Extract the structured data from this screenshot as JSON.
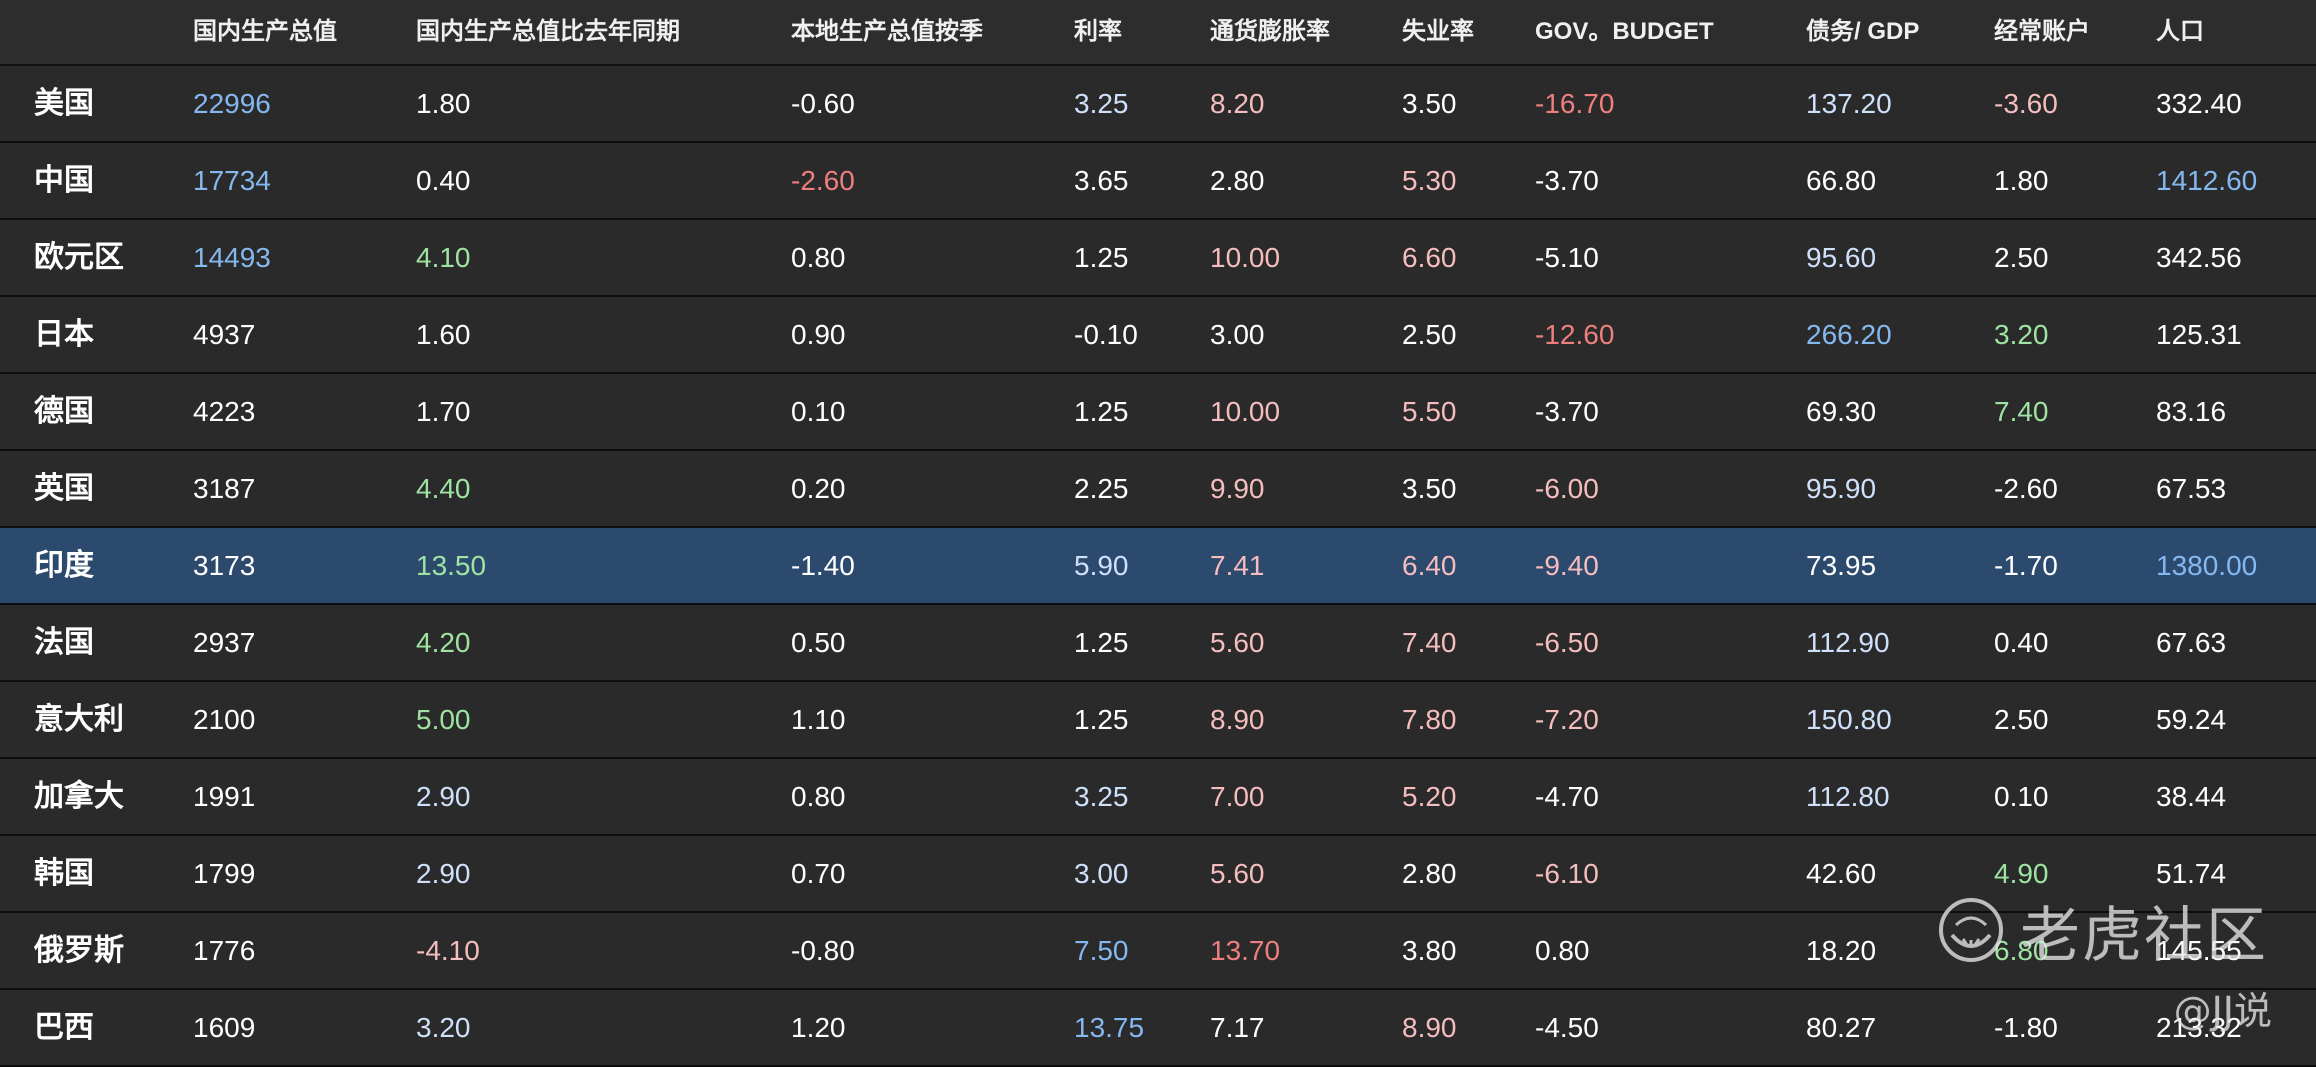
{
  "colors": {
    "background": "#2a2a2a",
    "highlight_row": "#2c4a6e",
    "white": "#ffffff",
    "blue": "#86b8f0",
    "light_blue": "#cfe0fb",
    "green": "#9ee3a2",
    "light_red": "#f5bdbd",
    "red": "#ef7f7f"
  },
  "table": {
    "headers": [
      "",
      "国内生产总值",
      "国内生产总值比去年同期",
      "本地生产总值按季",
      "利率",
      "通货膨胀率",
      "失业率",
      "GOV。BUDGET",
      "债务/ GDP",
      "经常账户",
      "人口"
    ],
    "highlight_index": 6,
    "rows": [
      {
        "cells": [
          "美国",
          "22996",
          "1.80",
          "-0.60",
          "3.25",
          "8.20",
          "3.50",
          "-16.70",
          "137.20",
          "-3.60",
          "332.40"
        ],
        "colors": [
          "white",
          "blue",
          "white",
          "white",
          "light_blue",
          "light_red",
          "white",
          "red",
          "light_blue",
          "light_red",
          "white"
        ]
      },
      {
        "cells": [
          "中国",
          "17734",
          "0.40",
          "-2.60",
          "3.65",
          "2.80",
          "5.30",
          "-3.70",
          "66.80",
          "1.80",
          "1412.60"
        ],
        "colors": [
          "white",
          "blue",
          "white",
          "red",
          "white",
          "white",
          "light_red",
          "white",
          "white",
          "white",
          "blue"
        ]
      },
      {
        "cells": [
          "欧元区",
          "14493",
          "4.10",
          "0.80",
          "1.25",
          "10.00",
          "6.60",
          "-5.10",
          "95.60",
          "2.50",
          "342.56"
        ],
        "colors": [
          "white",
          "blue",
          "green",
          "white",
          "white",
          "light_red",
          "light_red",
          "white",
          "light_blue",
          "white",
          "white"
        ]
      },
      {
        "cells": [
          "日本",
          "4937",
          "1.60",
          "0.90",
          "-0.10",
          "3.00",
          "2.50",
          "-12.60",
          "266.20",
          "3.20",
          "125.31"
        ],
        "colors": [
          "white",
          "white",
          "white",
          "white",
          "white",
          "white",
          "white",
          "red",
          "blue",
          "green",
          "white"
        ]
      },
      {
        "cells": [
          "德国",
          "4223",
          "1.70",
          "0.10",
          "1.25",
          "10.00",
          "5.50",
          "-3.70",
          "69.30",
          "7.40",
          "83.16"
        ],
        "colors": [
          "white",
          "white",
          "white",
          "white",
          "white",
          "light_red",
          "light_red",
          "white",
          "white",
          "green",
          "white"
        ]
      },
      {
        "cells": [
          "英国",
          "3187",
          "4.40",
          "0.20",
          "2.25",
          "9.90",
          "3.50",
          "-6.00",
          "95.90",
          "-2.60",
          "67.53"
        ],
        "colors": [
          "white",
          "white",
          "green",
          "white",
          "white",
          "light_red",
          "white",
          "light_red",
          "light_blue",
          "white",
          "white"
        ]
      },
      {
        "cells": [
          "印度",
          "3173",
          "13.50",
          "-1.40",
          "5.90",
          "7.41",
          "6.40",
          "-9.40",
          "73.95",
          "-1.70",
          "1380.00"
        ],
        "colors": [
          "white",
          "white",
          "green",
          "white",
          "light_blue",
          "light_red",
          "light_red",
          "light_red",
          "white",
          "white",
          "blue"
        ]
      },
      {
        "cells": [
          "法国",
          "2937",
          "4.20",
          "0.50",
          "1.25",
          "5.60",
          "7.40",
          "-6.50",
          "112.90",
          "0.40",
          "67.63"
        ],
        "colors": [
          "white",
          "white",
          "green",
          "white",
          "white",
          "light_red",
          "light_red",
          "light_red",
          "light_blue",
          "white",
          "white"
        ]
      },
      {
        "cells": [
          "意大利",
          "2100",
          "5.00",
          "1.10",
          "1.25",
          "8.90",
          "7.80",
          "-7.20",
          "150.80",
          "2.50",
          "59.24"
        ],
        "colors": [
          "white",
          "white",
          "green",
          "white",
          "white",
          "light_red",
          "light_red",
          "light_red",
          "light_blue",
          "white",
          "white"
        ]
      },
      {
        "cells": [
          "加拿大",
          "1991",
          "2.90",
          "0.80",
          "3.25",
          "7.00",
          "5.20",
          "-4.70",
          "112.80",
          "0.10",
          "38.44"
        ],
        "colors": [
          "white",
          "white",
          "light_blue",
          "white",
          "light_blue",
          "light_red",
          "light_red",
          "white",
          "light_blue",
          "white",
          "white"
        ]
      },
      {
        "cells": [
          "韩国",
          "1799",
          "2.90",
          "0.70",
          "3.00",
          "5.60",
          "2.80",
          "-6.10",
          "42.60",
          "4.90",
          "51.74"
        ],
        "colors": [
          "white",
          "white",
          "light_blue",
          "white",
          "light_blue",
          "light_red",
          "white",
          "light_red",
          "white",
          "green",
          "white"
        ]
      },
      {
        "cells": [
          "俄罗斯",
          "1776",
          "-4.10",
          "-0.80",
          "7.50",
          "13.70",
          "3.80",
          "0.80",
          "18.20",
          "6.80",
          "145.55"
        ],
        "colors": [
          "white",
          "white",
          "light_red",
          "white",
          "blue",
          "red",
          "white",
          "white",
          "white",
          "green",
          "white"
        ]
      },
      {
        "cells": [
          "巴西",
          "1609",
          "3.20",
          "1.20",
          "13.75",
          "7.17",
          "8.90",
          "-4.50",
          "80.27",
          "-1.80",
          "213.32"
        ],
        "colors": [
          "white",
          "white",
          "light_blue",
          "white",
          "blue",
          "white",
          "light_red",
          "white",
          "white",
          "white",
          "white"
        ]
      }
    ]
  },
  "watermark": {
    "brand": "老虎社区",
    "handle": "@JJ说"
  }
}
